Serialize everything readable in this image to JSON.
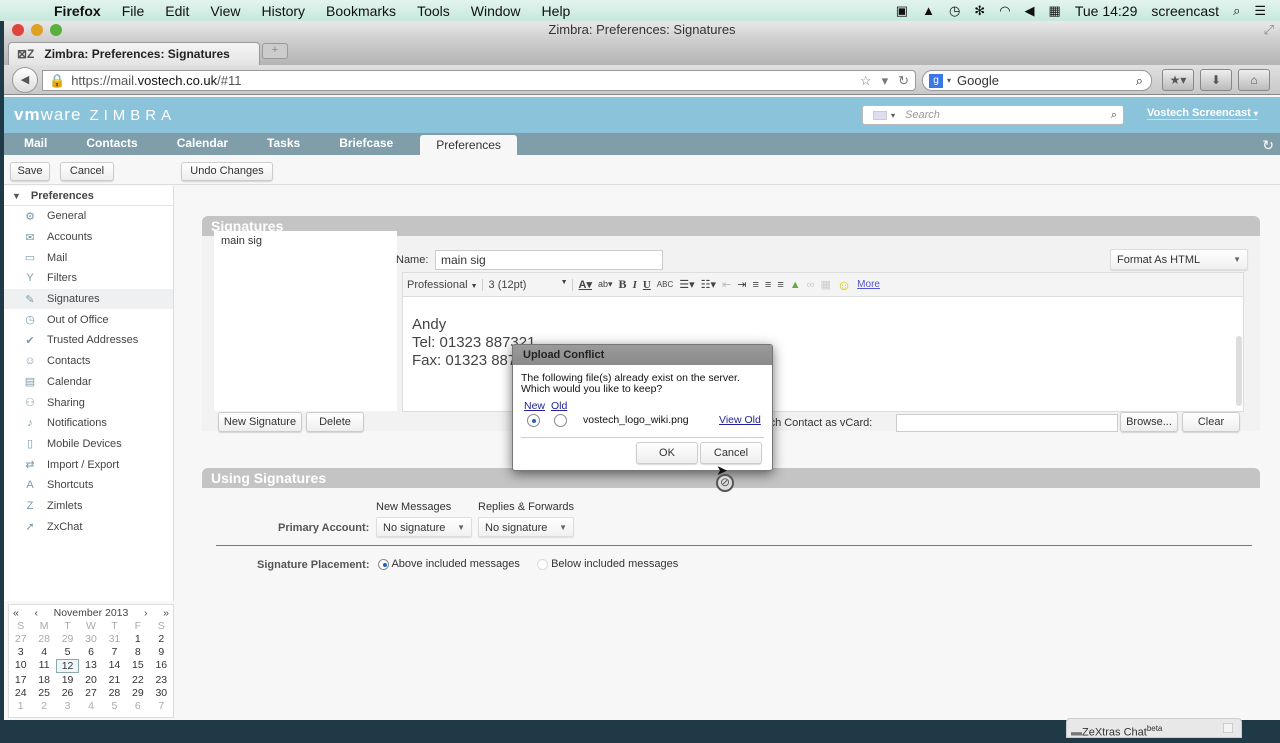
{
  "mac_menubar": {
    "app": "Firefox",
    "menus": [
      "File",
      "Edit",
      "View",
      "History",
      "Bookmarks",
      "Tools",
      "Window",
      "Help"
    ],
    "clock": "Tue 14:29",
    "user": "screencast"
  },
  "browser": {
    "window_title": "Zimbra: Preferences: Signatures",
    "tab_title": "Zimbra: Preferences: Signatures",
    "url_prefix": "https://mail.",
    "url_host": "vostech.co.uk",
    "url_suffix": "/#11",
    "search_engine": "Google"
  },
  "zimbra": {
    "logo_vm": "vm",
    "logo_ware": "ware",
    "logo_zimbra": "ZIMBRA",
    "search_placeholder": "Search",
    "user_name": "Vostech Screencast",
    "tabs": [
      "Mail",
      "Contacts",
      "Calendar",
      "Tasks",
      "Briefcase",
      "Preferences"
    ],
    "active_tab": "Preferences"
  },
  "toolbar": {
    "save": "Save",
    "cancel": "Cancel",
    "undo": "Undo Changes"
  },
  "sidebar": {
    "header": "Preferences",
    "items": [
      {
        "label": "General",
        "icon": "⚙"
      },
      {
        "label": "Accounts",
        "icon": "✉"
      },
      {
        "label": "Mail",
        "icon": "▭"
      },
      {
        "label": "Filters",
        "icon": "Y"
      },
      {
        "label": "Signatures",
        "icon": "✎"
      },
      {
        "label": "Out of Office",
        "icon": "◷"
      },
      {
        "label": "Trusted Addresses",
        "icon": "✔"
      },
      {
        "label": "Contacts",
        "icon": "☺"
      },
      {
        "label": "Calendar",
        "icon": "▤"
      },
      {
        "label": "Sharing",
        "icon": "⚇"
      },
      {
        "label": "Notifications",
        "icon": "♪"
      },
      {
        "label": "Mobile Devices",
        "icon": "▯"
      },
      {
        "label": "Import / Export",
        "icon": "⇄"
      },
      {
        "label": "Shortcuts",
        "icon": "A"
      },
      {
        "label": "Zimlets",
        "icon": "Z"
      },
      {
        "label": "ZxChat",
        "icon": "➚"
      }
    ],
    "selected": "Signatures"
  },
  "calendar": {
    "month": "November 2013",
    "dow": [
      "S",
      "M",
      "T",
      "W",
      "T",
      "F",
      "S"
    ],
    "weeks": [
      [
        "27",
        "28",
        "29",
        "30",
        "31",
        "1",
        "2"
      ],
      [
        "3",
        "4",
        "5",
        "6",
        "7",
        "8",
        "9"
      ],
      [
        "10",
        "11",
        "12",
        "13",
        "14",
        "15",
        "16"
      ],
      [
        "17",
        "18",
        "19",
        "20",
        "21",
        "22",
        "23"
      ],
      [
        "24",
        "25",
        "26",
        "27",
        "28",
        "29",
        "30"
      ],
      [
        "1",
        "2",
        "3",
        "4",
        "5",
        "6",
        "7"
      ]
    ],
    "today": "12"
  },
  "signatures": {
    "section_title": "Signatures",
    "list": [
      "main sig"
    ],
    "name_label": "Name:",
    "name_value": "main sig",
    "format": "Format As HTML",
    "font": "Professional",
    "size": "3 (12pt)",
    "more": "More",
    "body_lines": [
      "Andy",
      "Tel: 01323 887321",
      "Fax: 01323 887449"
    ],
    "new_button": "New Signature",
    "delete_button": "Delete",
    "vcard_label": "Attach Contact as vCard:",
    "browse": "Browse...",
    "clear": "Clear"
  },
  "using": {
    "section_title": "Using Signatures",
    "col_new": "New Messages",
    "col_reply": "Replies & Forwards",
    "primary_label": "Primary Account:",
    "new_value": "No signature",
    "reply_value": "No signature",
    "placement_label": "Signature Placement:",
    "above": "Above included messages",
    "below": "Below included messages",
    "placement_selected": "above"
  },
  "dialog": {
    "title": "Upload Conflict",
    "message_1": "The following file(s) already exist on the server.",
    "message_2": "Which would you like to keep?",
    "col_new": "New",
    "col_old": "Old",
    "filename": "vostech_logo_wiki.png",
    "view_old": "View Old",
    "ok": "OK",
    "cancel": "Cancel",
    "selected": "new"
  },
  "chat": {
    "label": "ZeXtras Chat",
    "sup": "beta"
  }
}
